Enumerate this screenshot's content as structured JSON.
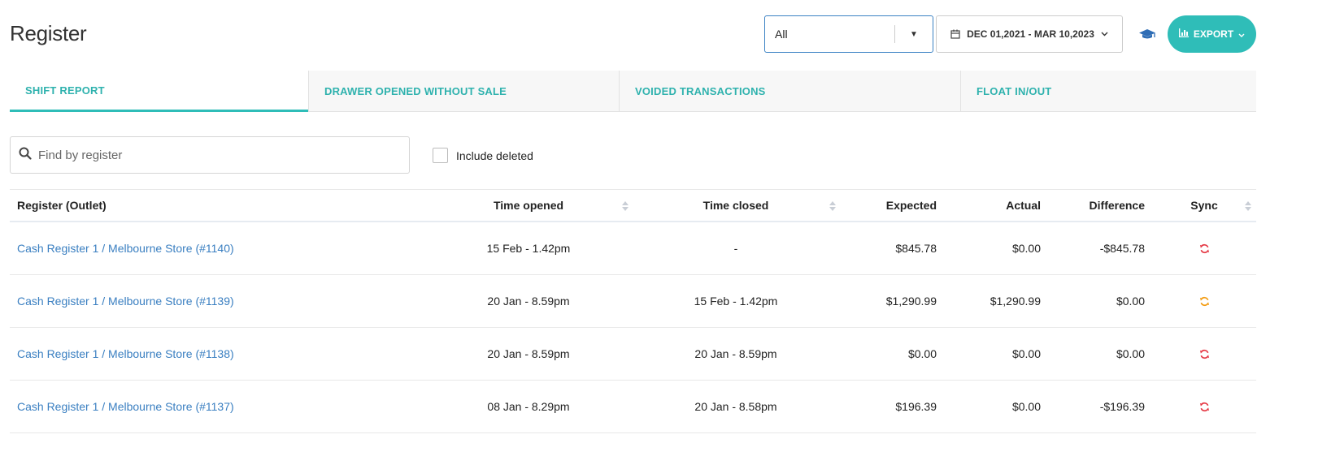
{
  "header": {
    "title": "Register",
    "outlet_filter": {
      "value": "All"
    },
    "date_range": "DEC 01,2021 - MAR 10,2023",
    "export_label": "EXPORT"
  },
  "tabs": [
    {
      "label": "SHIFT REPORT",
      "active": true
    },
    {
      "label": "DRAWER OPENED WITHOUT SALE",
      "active": false
    },
    {
      "label": "VOIDED TRANSACTIONS",
      "active": false
    },
    {
      "label": "FLOAT IN/OUT",
      "active": false
    }
  ],
  "search": {
    "placeholder": "Find by register",
    "value": ""
  },
  "include_deleted": {
    "label": "Include deleted",
    "checked": false
  },
  "table": {
    "columns": {
      "register": "Register (Outlet)",
      "time_opened": "Time opened",
      "time_closed": "Time closed",
      "expected": "Expected",
      "actual": "Actual",
      "difference": "Difference",
      "sync": "Sync"
    },
    "rows": [
      {
        "register": "Cash Register 1 / Melbourne Store (#1140)",
        "time_opened": "15 Feb - 1.42pm",
        "time_closed": "-",
        "expected": "$845.78",
        "actual": "$0.00",
        "difference": "-$845.78",
        "sync_color": "#e53945"
      },
      {
        "register": "Cash Register 1 / Melbourne Store (#1139)",
        "time_opened": "20 Jan - 8.59pm",
        "time_closed": "15 Feb - 1.42pm",
        "expected": "$1,290.99",
        "actual": "$1,290.99",
        "difference": "$0.00",
        "sync_color": "#f39c12"
      },
      {
        "register": "Cash Register 1 / Melbourne Store (#1138)",
        "time_opened": "20 Jan - 8.59pm",
        "time_closed": "20 Jan - 8.59pm",
        "expected": "$0.00",
        "actual": "$0.00",
        "difference": "$0.00",
        "sync_color": "#e53945"
      },
      {
        "register": "Cash Register 1 / Melbourne Store (#1137)",
        "time_opened": "08 Jan - 8.29pm",
        "time_closed": "20 Jan - 8.58pm",
        "expected": "$196.39",
        "actual": "$0.00",
        "difference": "-$196.39",
        "sync_color": "#e53945"
      }
    ]
  },
  "colors": {
    "accent": "#2fbdb8",
    "link": "#3a7fc1",
    "help_icon": "#2f6db5"
  }
}
